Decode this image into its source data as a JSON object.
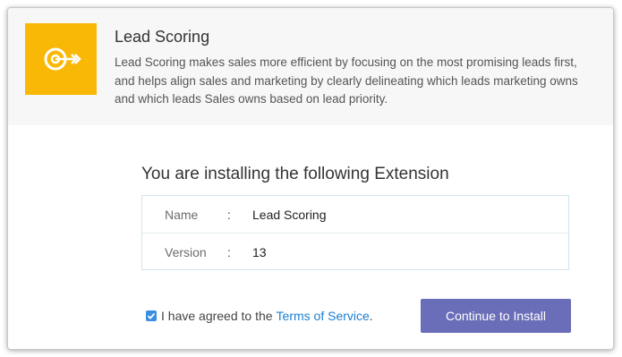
{
  "extension": {
    "icon": "target-dart-icon",
    "icon_color": "#f9b806",
    "title": "Lead Scoring",
    "description": "Lead Scoring makes sales more efficient by focusing on the most promising leads first, and helps align sales and marketing by clearly delineating which leads marketing owns and which leads Sales owns based on lead priority."
  },
  "install": {
    "heading": "You are installing the following Extension",
    "rows": [
      {
        "key": "Name",
        "colon": ":",
        "value": "Lead Scoring"
      },
      {
        "key": "Version",
        "colon": ":",
        "value": "13"
      }
    ]
  },
  "agreement": {
    "checked": true,
    "text": "I have agreed to the",
    "link_text": "Terms of Service",
    "suffix": "."
  },
  "actions": {
    "install_label": "Continue to Install",
    "button_color": "#6a6db8"
  }
}
